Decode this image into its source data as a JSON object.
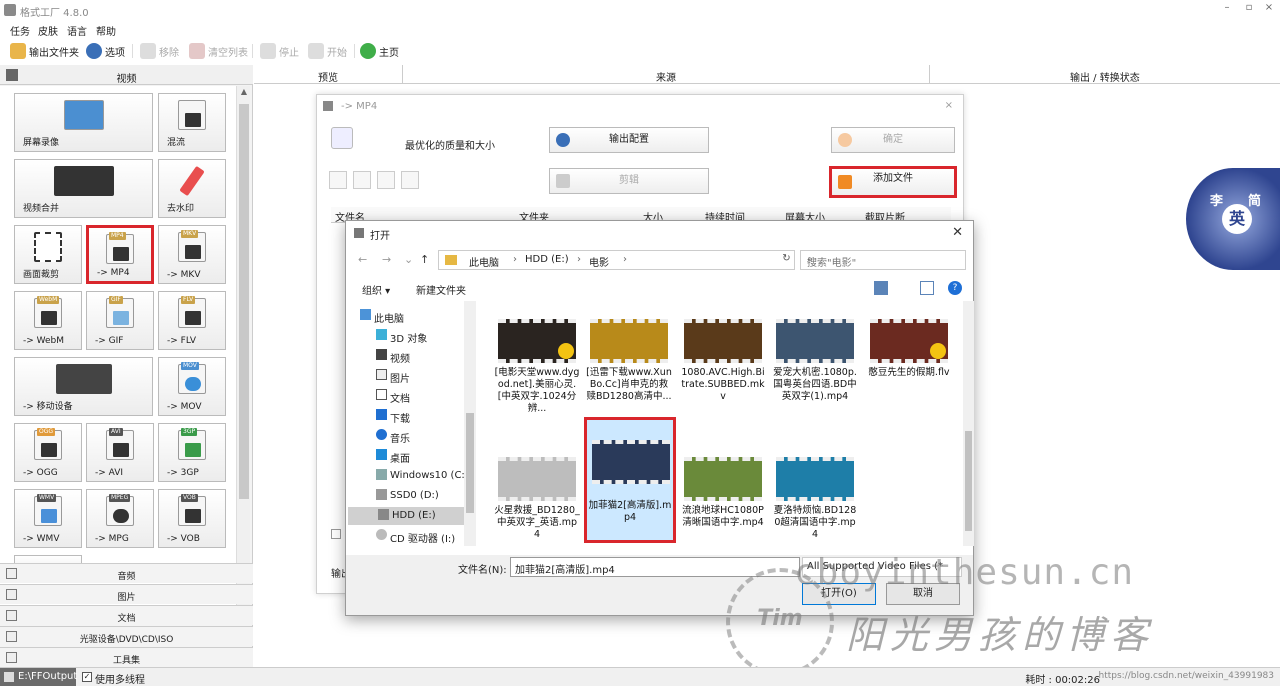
{
  "app": {
    "title": "格式工厂 4.8.0"
  },
  "window_controls": {
    "min": "–",
    "max": "▫",
    "close": "×"
  },
  "menu": [
    "任务",
    "皮肤",
    "语言",
    "帮助"
  ],
  "toolbar": {
    "output_folder": "输出文件夹",
    "options": "选项",
    "remove": "移除",
    "clear_list": "清空列表",
    "stop": "停止",
    "start": "开始",
    "home": "主页"
  },
  "left_panel": {
    "header": "视频",
    "tiles": [
      {
        "label": "屏幕录像",
        "tag": ""
      },
      {
        "label": "混流",
        "tag": ""
      },
      {
        "label": "视频合并",
        "tag": ""
      },
      {
        "label": "去水印",
        "tag": ""
      },
      {
        "label": "画面裁剪",
        "tag": ""
      },
      {
        "label": "-> MP4",
        "tag": "MP4"
      },
      {
        "label": "-> MKV",
        "tag": "MKV"
      },
      {
        "label": "-> WebM",
        "tag": "WebM"
      },
      {
        "label": "-> GIF",
        "tag": "GIF"
      },
      {
        "label": "-> FLV",
        "tag": "FLV"
      },
      {
        "label": "-> 移动设备",
        "tag": ""
      },
      {
        "label": "-> MOV",
        "tag": "MOV"
      },
      {
        "label": "-> OGG",
        "tag": "OGG"
      },
      {
        "label": "-> AVI",
        "tag": "AVI"
      },
      {
        "label": "-> 3GP",
        "tag": "3GP"
      },
      {
        "label": "-> WMV",
        "tag": "WMV"
      },
      {
        "label": "-> MPG",
        "tag": "MPEG"
      },
      {
        "label": "-> VOB",
        "tag": "VOB"
      }
    ],
    "categories": [
      "音频",
      "图片",
      "文档",
      "光驱设备\\DVD\\CD\\ISO",
      "工具集"
    ]
  },
  "columns": {
    "preview": "预览",
    "source": "来源",
    "output_status": "输出 / 转换状态"
  },
  "mp4_dialog": {
    "title": "-> MP4",
    "quality_label": "最优化的质量和大小",
    "output_config": "输出配置",
    "ok": "确定",
    "clip": "剪辑",
    "add_file": "添加文件",
    "file_columns": [
      "文件名",
      "文件夹",
      "大小",
      "持续时间",
      "屏幕大小",
      "截取片断"
    ],
    "output_label": "输出"
  },
  "open_dialog": {
    "title": "打开",
    "path": [
      "此电脑",
      "HDD (E:)",
      "电影"
    ],
    "search_placeholder": "搜索\"电影\"",
    "organize": "组织 ▾",
    "new_folder": "新建文件夹",
    "tree": [
      "此电脑",
      "3D 对象",
      "视频",
      "图片",
      "文档",
      "下载",
      "音乐",
      "桌面",
      "Windows10 (C:",
      "SSD0 (D:)",
      "HDD (E:)",
      "CD 驱动器 (I:)"
    ],
    "files": [
      {
        "name": "[电影天堂www.dygod.net].美丽心灵.[中英双字.1024分辨...",
        "badge": true,
        "light": false
      },
      {
        "name": "[迅雷下载www.XunBo.Cc]肖申克的救赎BD1280高清中...",
        "badge": false,
        "light": false
      },
      {
        "name": "1080.AVC.High.Bitrate.SUBBED.mkv",
        "badge": false,
        "light": false
      },
      {
        "name": "爱宠大机密.1080p.国粤英台四语.BD中英双字(1).mp4",
        "badge": false,
        "light": false
      },
      {
        "name": "憨豆先生的假期.flv",
        "badge": true,
        "light": false
      },
      {
        "name": "火星救援_BD1280_中英双字_英语.mp4",
        "badge": false,
        "light": true
      },
      {
        "name": "加菲猫2[高清版].mp4",
        "badge": false,
        "light": false
      },
      {
        "name": "流浪地球HC1080P清晰国语中字.mp4",
        "badge": false,
        "light": false
      },
      {
        "name": "夏洛特烦恼.BD1280超清国语中字.mp4",
        "badge": false,
        "light": false
      }
    ],
    "filename_label": "文件名(N):",
    "filename_value": "加菲猫2[高清版].mp4",
    "filter": "All Supported Video Files (*",
    "open_btn": "打开(O)",
    "cancel_btn": "取消"
  },
  "status": {
    "output_path": "E:\\FFOutput",
    "multithread": "使用多线程",
    "elapsed": "耗时 : 00:02:26",
    "url": "https://blog.csdn.net/weixin_43991983"
  },
  "watermark": {
    "url": "cboyinthesun.cn",
    "cn": "阳光男孩的博客",
    "sun": "Tim"
  },
  "logo": {
    "top_left": "李",
    "top_right": "简",
    "center": "英"
  },
  "colors": {
    "highlight": "#d9262c",
    "selected_file": "#cce8ff",
    "logo_blue": "#2f4590"
  }
}
